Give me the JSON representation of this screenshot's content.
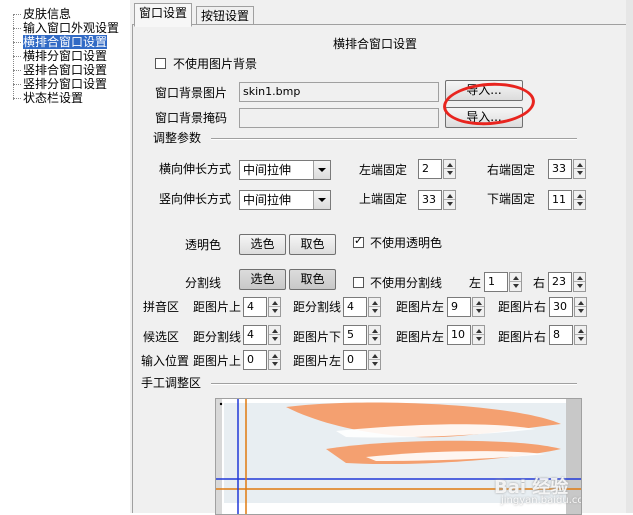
{
  "tree": {
    "items": [
      {
        "label": "皮肤信息"
      },
      {
        "label": "输入窗口外观设置"
      },
      {
        "label": "横排合窗口设置"
      },
      {
        "label": "横排分窗口设置"
      },
      {
        "label": "竖排合窗口设置"
      },
      {
        "label": "竖排分窗口设置"
      },
      {
        "label": "状态栏设置"
      }
    ]
  },
  "tabs": [
    {
      "label": "窗口设置"
    },
    {
      "label": "按钮设置"
    }
  ],
  "section_title": "横排合窗口设置",
  "no_image_bg_label": "不使用图片背景",
  "bg_image": {
    "label": "窗口背景图片",
    "value": "skin1.bmp",
    "import_label": "导入..."
  },
  "bg_mask": {
    "label": "窗口背景掩码",
    "value": "",
    "import_label": "导入..."
  },
  "adjust": {
    "group_label": "调整参数",
    "h_stretch_label": "横向伸长方式",
    "h_stretch_value": "中间拉伸",
    "v_stretch_label": "竖向伸长方式",
    "v_stretch_value": "中间拉伸",
    "left_fixed_label": "左端固定",
    "left_fixed_value": "2",
    "right_fixed_label": "右端固定",
    "right_fixed_value": "33",
    "top_fixed_label": "上端固定",
    "top_fixed_value": "33",
    "bottom_fixed_label": "下端固定",
    "bottom_fixed_value": "11"
  },
  "transparent": {
    "label": "透明色",
    "select_label": "选色",
    "pick_label": "取色",
    "no_transparent_label": "不使用透明色"
  },
  "divider": {
    "label": "分割线",
    "select_label": "选色",
    "pick_label": "取色",
    "no_divider_label": "不使用分割线",
    "left_label": "左",
    "left_value": "1",
    "right_label": "右",
    "right_value": "23"
  },
  "pinyin": {
    "label": "拼音区",
    "top_label": "距图片上",
    "top_value": "4",
    "div_label": "距分割线",
    "div_value": "4",
    "left_label": "距图片左",
    "left_value": "9",
    "right_label": "距图片右",
    "right_value": "30"
  },
  "candidate": {
    "label": "候选区",
    "div_label": "距分割线",
    "div_value": "4",
    "bottom_label": "距图片下",
    "bottom_value": "5",
    "left_label": "距图片左",
    "left_value": "10",
    "right_label": "距图片右",
    "right_value": "8"
  },
  "input_pos": {
    "label": "输入位置",
    "top_label": "距图片上",
    "top_value": "0",
    "left_label": "距图片左",
    "left_value": "0"
  },
  "manual": {
    "group_label": "手工调整区"
  },
  "colors": {
    "selection": "#316ac5",
    "annotation": "#e8241e",
    "guide_blue": "#2038d8",
    "guide_orange": "#e07a10",
    "skin_orange": "#f4a070"
  },
  "watermark": {
    "text": "Bai 经验",
    "sub": "jingyan.baidu.com"
  }
}
